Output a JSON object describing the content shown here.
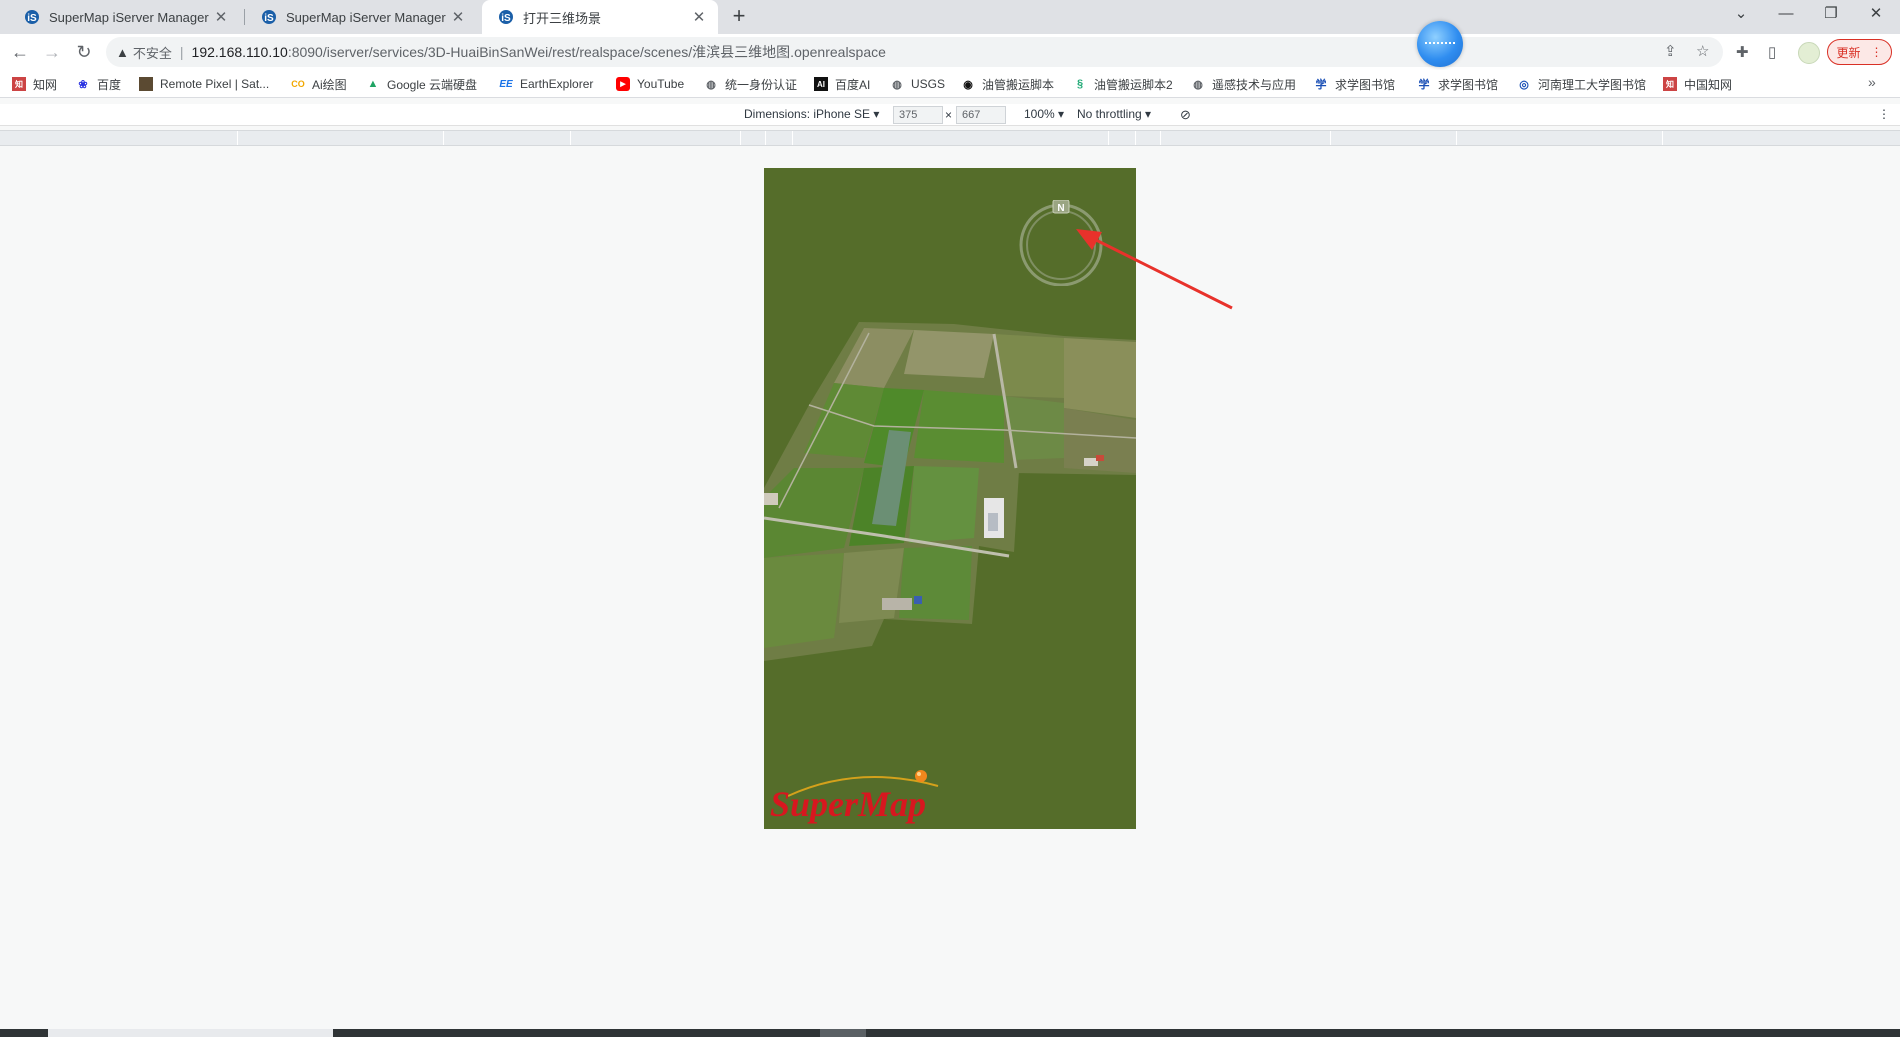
{
  "tabs": [
    {
      "title": "SuperMap iServer Manager",
      "close": "✕"
    },
    {
      "title": "SuperMap iServer Manager",
      "close": "✕"
    },
    {
      "title": "打开三维场景",
      "close": "✕"
    }
  ],
  "new_tab": "+",
  "window_controls": {
    "dropdown": "⌄",
    "minimize": "—",
    "restore": "❐",
    "close": "✕"
  },
  "toolbar": {
    "back": "←",
    "forward": "→",
    "reload": "↻",
    "security_label": "不安全",
    "url_host": "192.168.110.10",
    "url_path": ":8090/iserver/services/3D-HuaiBinSanWei/rest/realspace/scenes/淮滨县三维地图.openrealspace",
    "update_label": "更新"
  },
  "bookmarks": [
    {
      "label": "知网",
      "icon": "zhiwang-icon"
    },
    {
      "label": "百度",
      "icon": "baidu-paw-icon"
    },
    {
      "label": "Remote Pixel | Sat...",
      "icon": "remote-pixel-icon"
    },
    {
      "label": "Ai绘图",
      "icon": "co-icon"
    },
    {
      "label": "Google 云端硬盘",
      "icon": "google-drive-icon"
    },
    {
      "label": "EarthExplorer",
      "icon": "ee-icon"
    },
    {
      "label": "YouTube",
      "icon": "youtube-icon"
    },
    {
      "label": "统一身份认证",
      "icon": "globe-icon"
    },
    {
      "label": "百度AI",
      "icon": "ai-icon"
    },
    {
      "label": "USGS",
      "icon": "globe-icon"
    },
    {
      "label": "油管搬运脚本",
      "icon": "script-icon"
    },
    {
      "label": "油管搬运脚本2",
      "icon": "script-icon"
    },
    {
      "label": "遥感技术与应用",
      "icon": "globe-icon"
    },
    {
      "label": "求学图书馆",
      "icon": "xue-icon"
    },
    {
      "label": "求学图书馆",
      "icon": "xue-icon"
    },
    {
      "label": "河南理工大学图书馆",
      "icon": "library-icon"
    },
    {
      "label": "中国知网",
      "icon": "zhiwang-icon"
    }
  ],
  "bookmarks_more": "»",
  "devtools": {
    "dimensions_label": "Dimensions: iPhone SE ▾",
    "width": "375",
    "times": "×",
    "height": "667",
    "zoom": "100% ▾",
    "throttling": "No throttling ▾",
    "more": "⋮"
  },
  "scene": {
    "compass_letter": "N",
    "logo_text": "SuperMap",
    "colors": {
      "terrain": "#556d2a",
      "logo": "#d7171f",
      "arrow": "#e8322b"
    }
  }
}
